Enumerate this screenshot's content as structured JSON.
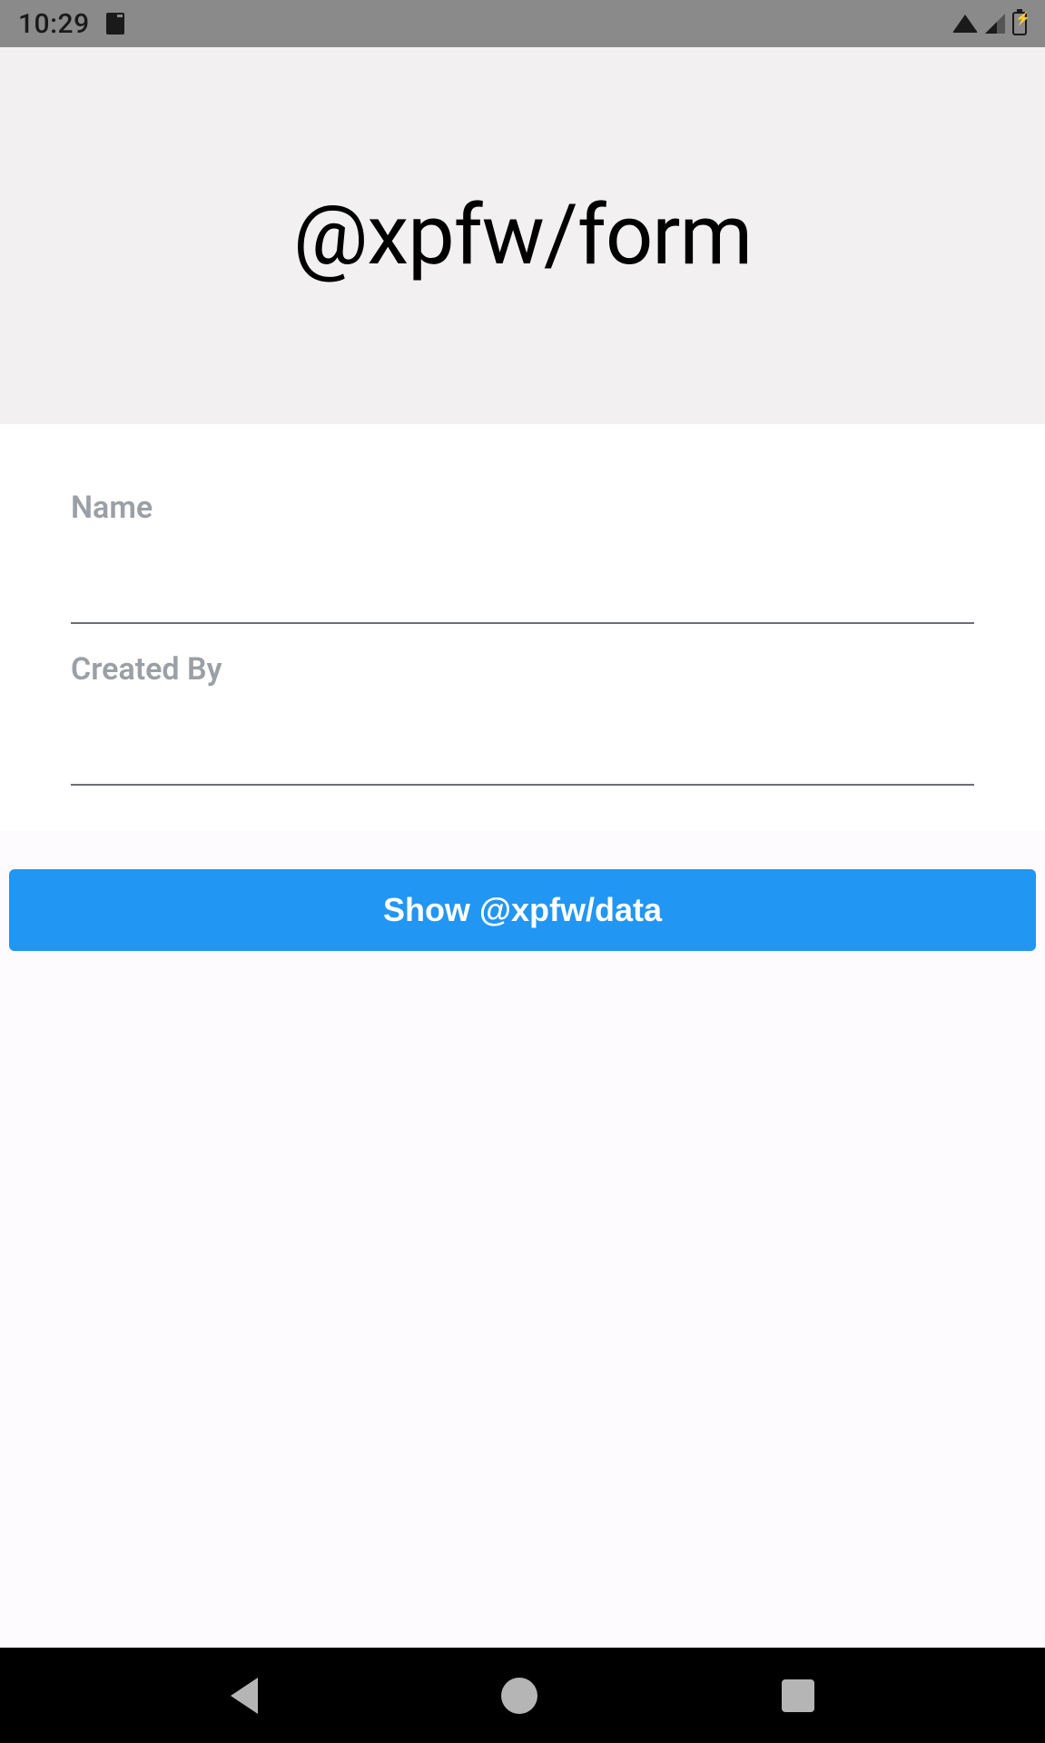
{
  "status_bar": {
    "time": "10:29"
  },
  "header": {
    "title": "@xpfw/form"
  },
  "form": {
    "fields": [
      {
        "label": "Name",
        "value": ""
      },
      {
        "label": "Created By",
        "value": ""
      }
    ]
  },
  "action_button": {
    "label": "Show @xpfw/data"
  }
}
